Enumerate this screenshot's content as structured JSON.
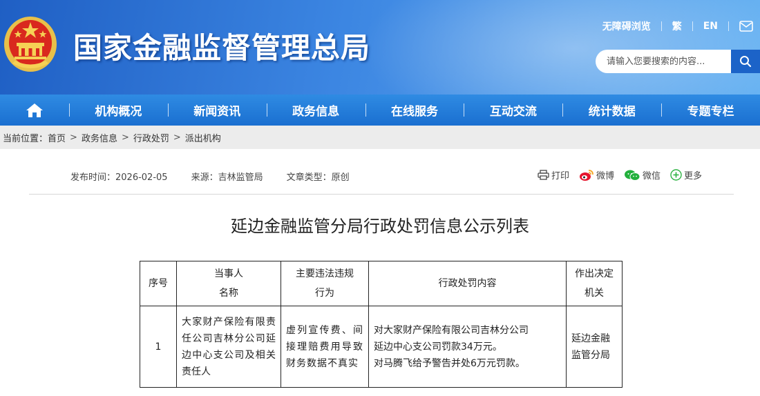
{
  "header": {
    "site_title": "国家金融监督管理总局",
    "accessibility_label": "无障碍浏览",
    "traditional_label": "繁",
    "english_label": "EN",
    "search_placeholder": "请输入您要搜索的内容...",
    "brand_color": "#2a74d6"
  },
  "nav": {
    "items": [
      {
        "label": "机构概况"
      },
      {
        "label": "新闻资讯"
      },
      {
        "label": "政务信息"
      },
      {
        "label": "在线服务"
      },
      {
        "label": "互动交流"
      },
      {
        "label": "统计数据"
      },
      {
        "label": "专题专栏"
      }
    ]
  },
  "breadcrumb": {
    "prefix": "当前位置：",
    "items": [
      "首页",
      "政务信息",
      "行政处罚",
      "派出机构"
    ]
  },
  "meta": {
    "publish_time": "发布时间：2026-02-05",
    "source": "来源：吉林监管局",
    "type": "文章类型：原创"
  },
  "share": {
    "print": "打印",
    "weibo": "微博",
    "wechat": "微信",
    "more": "更多"
  },
  "article": {
    "title": "延边金融监管分局行政处罚信息公示列表"
  },
  "table": {
    "headers": {
      "no": "序号",
      "party_1": "当事人",
      "party_2": "名称",
      "act_1": "主要违法违规",
      "act_2": "行为",
      "content": "行政处罚内容",
      "org_1": "作出决定",
      "org_2": "机关"
    },
    "rows": [
      {
        "no": "1",
        "party": "大家财产保险有限责任公司吉林分公司延边中心支公司及相关责任人",
        "act": "虚列宣传费、间接理赔费用导致财务数据不真实",
        "content_1": "对大家财产保险有限公司吉林分公司",
        "content_2": "延边中心支公司罚款34万元。",
        "content_3": "对马腾飞给予警告并处6万元罚款。",
        "org": "延边金融监管分局"
      }
    ]
  }
}
